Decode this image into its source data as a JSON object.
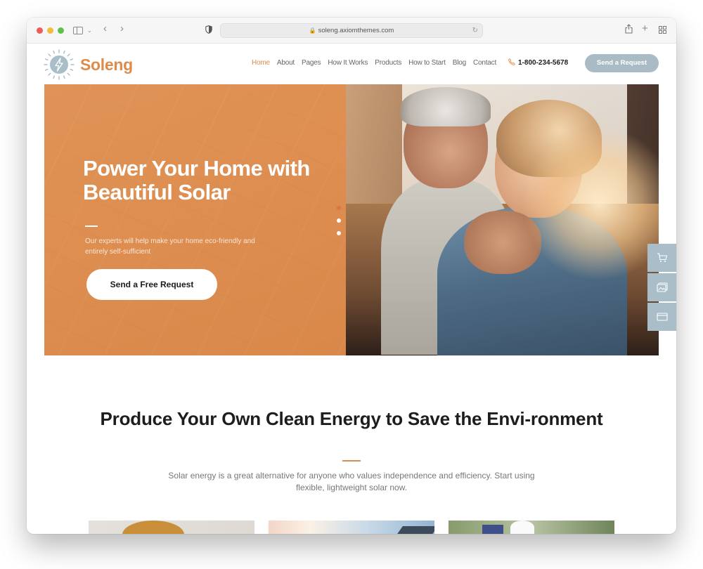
{
  "browser": {
    "url": "soleng.axiomthemes.com",
    "icons": [
      "sidebar-icon",
      "chevron-down-icon",
      "back-icon",
      "forward-icon",
      "shield-icon",
      "lock-icon",
      "reload-icon",
      "share-icon",
      "new-tab-icon",
      "tab-overview-icon"
    ]
  },
  "header": {
    "brand": "Soleng",
    "nav": [
      {
        "label": "Home",
        "active": true
      },
      {
        "label": "About",
        "active": false
      },
      {
        "label": "Pages",
        "active": false
      },
      {
        "label": "How It Works",
        "active": false
      },
      {
        "label": "Products",
        "active": false
      },
      {
        "label": "How to Start",
        "active": false
      },
      {
        "label": "Blog",
        "active": false
      },
      {
        "label": "Contact",
        "active": false
      }
    ],
    "phone": "1-800-234-5678",
    "cta": "Send a Request"
  },
  "hero": {
    "title": "Power Your Home with Beautiful Solar",
    "subtitle": "Our experts will help make your home eco-friendly and entirely self-sufficient",
    "cta": "Send a Free Request",
    "slides": 3,
    "active_slide": 1
  },
  "side_panel": {
    "items": [
      "cart-icon",
      "gallery-icon",
      "window-icon"
    ]
  },
  "intro": {
    "title": "Produce Your Own Clean Energy to Save the Envi-ronment",
    "text": "Solar energy is a great alternative for anyone who values independence and efficiency. Start using flexible, lightweight solar now."
  },
  "colors": {
    "accent": "#dd8c4b",
    "hero_bg": "#de8f53",
    "button_blue": "#a9bcc6",
    "heading": "#1d1d1d"
  }
}
